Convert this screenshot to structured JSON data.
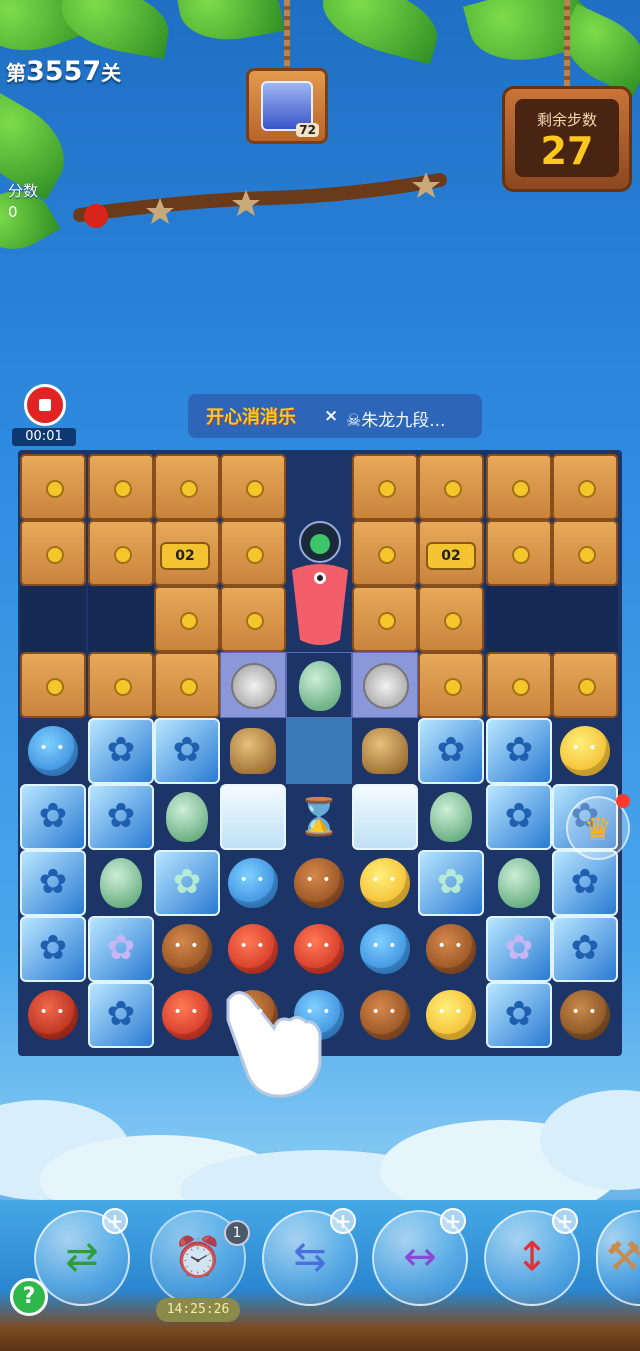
{
  "hud": {
    "level_prefix": "第",
    "level_number": "3557",
    "level_suffix": "关",
    "score_label": "分数",
    "score_value": "0",
    "goal_count": "72",
    "moves_label": "剩余步数",
    "moves_value": "27"
  },
  "recording": {
    "timer": "00:01"
  },
  "banner": {
    "logo": "开心消消乐",
    "x_mark": "×",
    "player_name": "☠朱龙九段..."
  },
  "board": {
    "crate_tags": [
      "02",
      "02"
    ]
  },
  "boosters": {
    "badge_count": "1",
    "timer": "14:25:26",
    "plus": "+"
  },
  "help": "?",
  "colors": {
    "accent_yellow": "#ffc81e",
    "stop_red": "#e02424",
    "board_bg": "#1c3566"
  }
}
